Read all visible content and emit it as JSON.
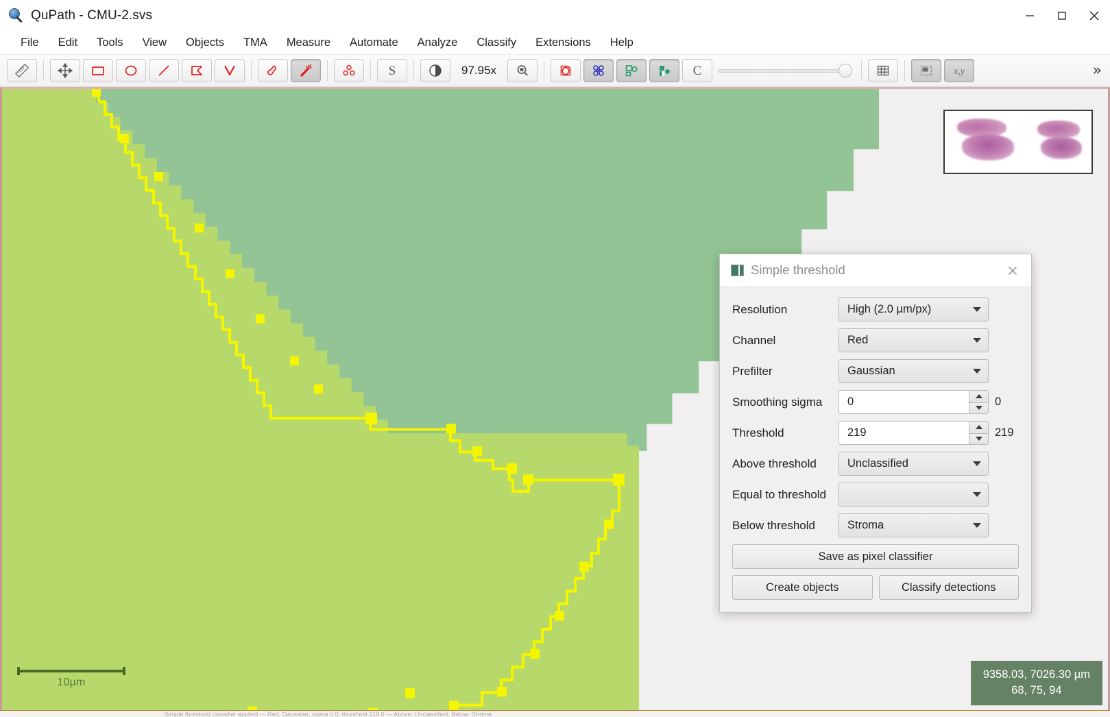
{
  "window": {
    "title": "QuPath - CMU-2.svs",
    "icon": "qupath-logo-icon",
    "minimize_label": "Minimize",
    "maximize_label": "Maximize",
    "close_label": "Close"
  },
  "menubar": {
    "items": [
      {
        "label": "File",
        "name": "menu-file"
      },
      {
        "label": "Edit",
        "name": "menu-edit"
      },
      {
        "label": "Tools",
        "name": "menu-tools"
      },
      {
        "label": "View",
        "name": "menu-view"
      },
      {
        "label": "Objects",
        "name": "menu-objects"
      },
      {
        "label": "TMA",
        "name": "menu-tma"
      },
      {
        "label": "Measure",
        "name": "menu-measure"
      },
      {
        "label": "Automate",
        "name": "menu-automate"
      },
      {
        "label": "Analyze",
        "name": "menu-analyze"
      },
      {
        "label": "Classify",
        "name": "menu-classify"
      },
      {
        "label": "Extensions",
        "name": "menu-extensions"
      },
      {
        "label": "Help",
        "name": "menu-help"
      }
    ]
  },
  "toolbar": {
    "zoom_level": "97.95x",
    "overflow_label": "»",
    "icons": [
      "ruler-icon",
      "move-icon",
      "rectangle-icon",
      "ellipse-icon",
      "line-icon",
      "polygon-icon",
      "polyline-icon",
      "brush-icon",
      "wand-icon",
      "points-icon",
      "script-letter-s-icon",
      "brightness-contrast-icon",
      "zoom-to-fit-icon",
      "show-annotations-icon",
      "show-detections-icon",
      "show-classification-icon",
      "show-pixel-classification-icon",
      "classification-c-icon",
      "opacity-slider",
      "grid-icon",
      "overview-icon",
      "location-xy-icon"
    ]
  },
  "dialog": {
    "title": "Simple threshold",
    "icon": "threshold-icon",
    "close_icon": "close-icon",
    "fields": [
      {
        "label": "Resolution",
        "value": "High (2.0 µm/px)",
        "type": "combo"
      },
      {
        "label": "Channel",
        "value": "Red",
        "type": "combo"
      },
      {
        "label": "Prefilter",
        "value": "Gaussian",
        "type": "combo"
      },
      {
        "label": "Smoothing sigma",
        "value": "0",
        "side": "0",
        "type": "spinner"
      },
      {
        "label": "Threshold",
        "value": "219",
        "side": "219",
        "type": "spinner"
      },
      {
        "label": "Above threshold",
        "value": "Unclassified",
        "type": "combo"
      },
      {
        "label": "Equal to threshold",
        "value": "",
        "type": "combo"
      },
      {
        "label": "Below threshold",
        "value": "Stroma",
        "type": "combo"
      }
    ],
    "buttons": {
      "save": "Save as pixel classifier",
      "create": "Create objects",
      "classify": "Classify detections"
    }
  },
  "viewer": {
    "scalebar_label": "10µm",
    "location": {
      "coordinates": "9358.03, 7026.30 µm",
      "pixel_values": "68, 75, 94"
    },
    "minimap_name": "slide-overview-thumbnail",
    "annotation_color": "#f5f500",
    "stroma_color": "#93c495",
    "unclassified_color": "#b7d86a",
    "background_color": "#f2eff1"
  },
  "statusbar": {
    "text": "Simple threshold classifier applied — Red, Gaussian, sigma 0.0, threshold 219.0 — Above: Unclassified, Below: Stroma"
  }
}
